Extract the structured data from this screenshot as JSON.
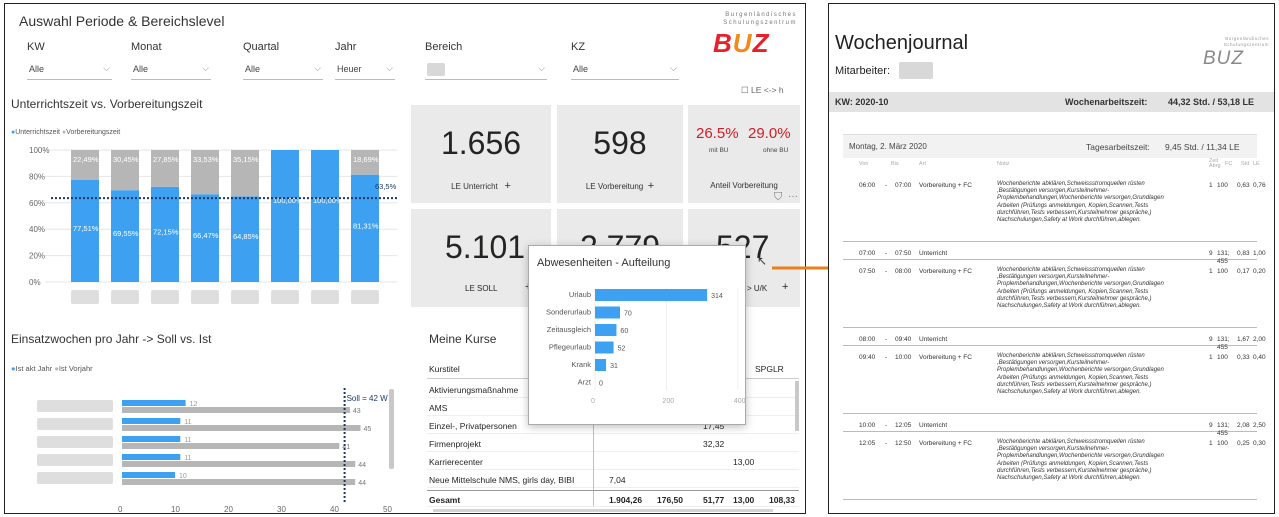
{
  "dashboard": {
    "title": "Auswahl Periode & Bereichslevel",
    "logo_text": "Burgenländisches Schulungszentrum",
    "logo_mark": "BUZ",
    "slicers": [
      {
        "label": "KW",
        "value": "Alle"
      },
      {
        "label": "Monat",
        "value": "Alle"
      },
      {
        "label": "Quartal",
        "value": "Alle"
      },
      {
        "label": "Jahr",
        "value": "Heuer"
      },
      {
        "label": "Bereich",
        "value": ""
      },
      {
        "label": "KZ",
        "value": "Alle"
      }
    ],
    "le_toggle": "LE <-> h",
    "cards": {
      "le_unterricht": {
        "value": "1.656",
        "label": "LE Unterricht"
      },
      "le_vorbereitung": {
        "value": "598",
        "label": "LE Vorbereitung"
      },
      "anteil": {
        "pct1": "26.5%",
        "pct1_label": "mit BU",
        "pct2": "29.0%",
        "pct2_label": "ohne BU",
        "label": "Anteil Vorbereitung"
      },
      "le_soll": {
        "value": "5.101",
        "label": "LE SOLL"
      },
      "mid": {
        "value": "2.779"
      },
      "uk": {
        "value": "527",
        "label": "T > U/K"
      }
    },
    "plus": "+"
  },
  "chart_data": [
    {
      "type": "bar",
      "title": "Unterrichtszeit vs. Vorbereitungszeit",
      "legend": [
        "Unterrichtszeit",
        "Vorbereitungszeit"
      ],
      "legend_position": "top-left",
      "stacked": true,
      "colors": [
        "#3ea0f0",
        "#b6b6b6"
      ],
      "categories": [
        "",
        "",
        "",
        "",
        "",
        "",
        "",
        ""
      ],
      "series": [
        {
          "name": "Unterrichtszeit",
          "values": [
            77.51,
            69.55,
            72.15,
            66.47,
            64.85,
            100.0,
            100.0,
            81.31
          ],
          "labels": [
            "77,51%",
            "69,55%",
            "72,15%",
            "66,47%",
            "64,85%",
            "100,00%",
            "100,00%",
            "81,31%"
          ]
        },
        {
          "name": "Vorbereitungszeit",
          "values": [
            22.49,
            30.45,
            27.85,
            33.53,
            35.15,
            0,
            0,
            18.69
          ],
          "labels": [
            "22,49%",
            "30,45%",
            "27,85%",
            "33,53%",
            "35,15%",
            "",
            "",
            "18,69%"
          ]
        }
      ],
      "y_ticks": [
        "100%",
        "80%",
        "60%",
        "40%",
        "20%",
        "0%"
      ],
      "ylim": [
        0,
        100
      ],
      "reference_line": {
        "value": 63.5,
        "label": "63,5%"
      }
    },
    {
      "type": "bar",
      "orientation": "horizontal",
      "title": "Einsatzwochen pro Jahr -> Soll vs. Ist",
      "legend": [
        "Ist akt Jahr",
        "Ist Vorjahr"
      ],
      "colors": [
        "#3ea0f0",
        "#b6b6b6"
      ],
      "categories": [
        "",
        "",
        "",
        "",
        ""
      ],
      "series": [
        {
          "name": "Ist akt Jahr",
          "values": [
            12,
            11,
            11,
            11,
            10
          ]
        },
        {
          "name": "Ist Vorjahr",
          "values": [
            43,
            45,
            41,
            44,
            44
          ]
        }
      ],
      "x_ticks": [
        "0",
        "10",
        "20",
        "30",
        "40",
        "50"
      ],
      "xlim": [
        0,
        50
      ],
      "xlabel": "Wochen",
      "reference_line": {
        "value": 42,
        "label": "Soll = 42 W"
      }
    },
    {
      "type": "bar",
      "orientation": "horizontal",
      "title": "Abwesenheiten - Aufteilung",
      "categories": [
        "Urlaub",
        "Sonderurlaub",
        "Zeitausgleich",
        "Pflegeurlaub",
        "Krank",
        "Arzt"
      ],
      "values": [
        314,
        70,
        60,
        52,
        31,
        0
      ],
      "color": "#3ea0f0",
      "x_ticks": [
        "0",
        "200",
        "400"
      ],
      "xlim": [
        0,
        420
      ]
    }
  ],
  "kurse": {
    "title": "Meine Kurse",
    "columns": [
      "Kurstitel",
      "SPGLR"
    ],
    "rows": [
      {
        "title": "Aktivierungsmaßnahme",
        "c1": "",
        "c2": "",
        "c3": "",
        "c4": "",
        "c5": ""
      },
      {
        "title": "AMS",
        "c1": "",
        "c2": "",
        "c3": "",
        "c4": "",
        "c5": ""
      },
      {
        "title": "Einzel-, Privatpersonen",
        "c1": "",
        "c2": "",
        "c3": "17,45",
        "c4": "",
        "c5": ""
      },
      {
        "title": "Firmenprojekt",
        "c1": "",
        "c2": "",
        "c3": "32,32",
        "c4": "",
        "c5": ""
      },
      {
        "title": "Karrierecenter",
        "c1": "",
        "c2": "",
        "c3": "",
        "c4": "13,00",
        "c5": ""
      },
      {
        "title": "Neue Mittelschule NMS, girls day, BIBI",
        "c1": "7,04",
        "c2": "",
        "c3": "",
        "c4": "",
        "c5": ""
      }
    ],
    "total": {
      "title": "Gesamt",
      "c1": "1.904,26",
      "c2": "176,50",
      "c3": "51,77",
      "c4": "13,00",
      "c5": "108,33"
    }
  },
  "journal": {
    "title": "Wochenjournal",
    "mitarbeiter_label": "Mitarbeiter:",
    "kw": "KW: 2020-10",
    "wochen_label": "Wochenarbeitszeit:",
    "wochen_value": "44,32 Std. / 53,18 LE",
    "day": "Montag, 2. März 2020",
    "tages_label": "Tagesarbeitszeit:",
    "tages_value": "9,45 Std. / 11,34 LE",
    "col_headers": [
      "Von",
      "Bis",
      "Art",
      "Notiz",
      "Zeit Abrg",
      "FC",
      "Std",
      "LE"
    ],
    "entries": [
      {
        "from": "06:00",
        "to": "07:00",
        "art": "Vorbereitung + FC",
        "note": "Wochenberichte abklären,Schweissstromquellen rüsten ,Bestätigungen versorgen,Kursteilnehmer-Proplembehandlungen,Wochenberichte versorgen,Grundlagen Arbeiten (Prüfungs anmeldungen, Kopien,Scannen,Tests durchführen,Tests verbessern,Kursteilnehmer gespräche,) Nachschulungen,Safety at Work durchführen,ablegen.",
        "n1": "1",
        "n2": "100",
        "std": "0,63",
        "le": "0,76"
      },
      {
        "from": "07:00",
        "to": "07:50",
        "art": "Unterricht",
        "note": "",
        "n1": "9",
        "n2": "131; 455",
        "std": "0,83",
        "le": "1,00"
      },
      {
        "from": "07:50",
        "to": "08:00",
        "art": "Vorbereitung + FC",
        "note": "Wochenberichte abklären,Schweissstromquellen rüsten ,Bestätigungen versorgen,Kursteilnehmer-Proplembehandlungen,Wochenberichte versorgen,Grundlagen Arbeiten (Prüfungs anmeldungen, Kopien,Scannen,Tests durchführen,Tests verbessern,Kursteilnehmer gespräche,) Nachschulungen,Safety at Work durchführen,ablegen.",
        "n1": "1",
        "n2": "100",
        "std": "0,17",
        "le": "0,20"
      },
      {
        "from": "08:00",
        "to": "09:40",
        "art": "Unterricht",
        "note": "",
        "n1": "9",
        "n2": "131; 455",
        "std": "1,67",
        "le": "2,00"
      },
      {
        "from": "09:40",
        "to": "10:00",
        "art": "Vorbereitung + FC",
        "note": "Wochenberichte abklären,Schweissstromquellen rüsten ,Bestätigungen versorgen,Kursteilnehmer-Proplembehandlungen,Wochenberichte versorgen,Grundlagen Arbeiten (Prüfungs anmeldungen, Kopien,Scannen,Tests durchführen,Tests verbessern,Kursteilnehmer gespräche,) Nachschulungen,Safety at Work durchführen,ablegen.",
        "n1": "1",
        "n2": "100",
        "std": "0,33",
        "le": "0,40"
      },
      {
        "from": "10:00",
        "to": "12:05",
        "art": "Unterricht",
        "note": "",
        "n1": "9",
        "n2": "131; 455",
        "std": "2,08",
        "le": "2,50"
      },
      {
        "from": "12:05",
        "to": "12:50",
        "art": "Vorbereitung + FC",
        "note": "Wochenberichte abklären,Schweissstromquellen rüsten ,Bestätigungen versorgen,Kursteilnehmer-Proplembehandlungen,Wochenberichte versorgen,Grundlagen Arbeiten (Prüfungs anmeldungen, Kopien,Scannen,Tests durchführen,Tests verbessern,Kursteilnehmer gespräche,) Nachschulungen,Safety at Work durchführen,ablegen.",
        "n1": "1",
        "n2": "100",
        "std": "0,25",
        "le": "0,30"
      }
    ]
  }
}
